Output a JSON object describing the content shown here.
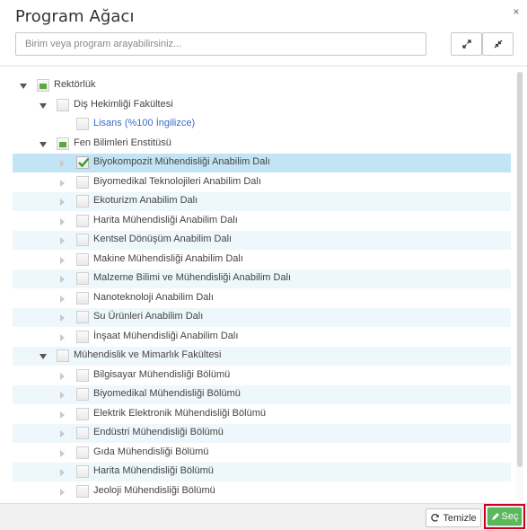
{
  "dialog": {
    "title": "Program Ağacı",
    "close_glyph": "×"
  },
  "search": {
    "placeholder": "Birim veya program arayabilirsiniz..."
  },
  "toolbar": {
    "expand_icon": "expand-icon",
    "collapse_icon": "collapse-icon"
  },
  "tree": {
    "rows": [
      {
        "label": "Rektörlük",
        "level": 0,
        "toggle": "expanded",
        "check": "partial",
        "bg": "none",
        "link": false
      },
      {
        "label": "Diş Hekimliği Fakültesi",
        "level": 1,
        "toggle": "expanded",
        "check": "none",
        "bg": "none",
        "link": false
      },
      {
        "label": "Lisans (%100 İngilizce)",
        "level": 2,
        "toggle": "none",
        "check": "none",
        "bg": "none",
        "link": true
      },
      {
        "label": "Fen Bilimleri Enstitüsü",
        "level": 1,
        "toggle": "expanded",
        "check": "partial",
        "bg": "none",
        "link": false
      },
      {
        "label": "Biyokompozit Mühendisliği Anabilim Dalı",
        "level": 2,
        "toggle": "collapsed",
        "check": "checked",
        "bg": "selected",
        "link": false
      },
      {
        "label": "Biyomedikal Teknolojileri Anabilim Dalı",
        "level": 2,
        "toggle": "collapsed",
        "check": "none",
        "bg": "none",
        "link": false
      },
      {
        "label": "Ekoturizm Anabilim Dalı",
        "level": 2,
        "toggle": "collapsed",
        "check": "none",
        "bg": "alt",
        "link": false
      },
      {
        "label": "Harita Mühendisliği Anabilim Dalı",
        "level": 2,
        "toggle": "collapsed",
        "check": "none",
        "bg": "none",
        "link": false
      },
      {
        "label": "Kentsel Dönüşüm Anabilim Dalı",
        "level": 2,
        "toggle": "collapsed",
        "check": "none",
        "bg": "alt",
        "link": false
      },
      {
        "label": "Makine Mühendisliği Anabilim Dalı",
        "level": 2,
        "toggle": "collapsed",
        "check": "none",
        "bg": "none",
        "link": false
      },
      {
        "label": "Malzeme Bilimi ve Mühendisliği Anabilim Dalı",
        "level": 2,
        "toggle": "collapsed",
        "check": "none",
        "bg": "alt",
        "link": false
      },
      {
        "label": "Nanoteknoloji Anabilim Dalı",
        "level": 2,
        "toggle": "collapsed",
        "check": "none",
        "bg": "none",
        "link": false
      },
      {
        "label": "Su Ürünleri Anabilim Dalı",
        "level": 2,
        "toggle": "collapsed",
        "check": "none",
        "bg": "alt",
        "link": false
      },
      {
        "label": "İnşaat Mühendisliği Anabilim Dalı",
        "level": 2,
        "toggle": "collapsed",
        "check": "none",
        "bg": "none",
        "link": false
      },
      {
        "label": "Mühendislik ve Mimarlık Fakültesi",
        "level": 1,
        "toggle": "expanded",
        "check": "none",
        "bg": "alt",
        "link": false
      },
      {
        "label": "Bilgisayar Mühendisliği Bölümü",
        "level": 2,
        "toggle": "collapsed",
        "check": "none",
        "bg": "none",
        "link": false
      },
      {
        "label": "Biyomedikal Mühendisliği Bölümü",
        "level": 2,
        "toggle": "collapsed",
        "check": "none",
        "bg": "alt",
        "link": false
      },
      {
        "label": "Elektrik Elektronik Mühendisliği Bölümü",
        "level": 2,
        "toggle": "collapsed",
        "check": "none",
        "bg": "none",
        "link": false
      },
      {
        "label": "Endüstri Mühendisliği Bölümü",
        "level": 2,
        "toggle": "collapsed",
        "check": "none",
        "bg": "alt",
        "link": false
      },
      {
        "label": "Gıda Mühendisliği Bölümü",
        "level": 2,
        "toggle": "collapsed",
        "check": "none",
        "bg": "none",
        "link": false
      },
      {
        "label": "Harita Mühendisliği Bölümü",
        "level": 2,
        "toggle": "collapsed",
        "check": "none",
        "bg": "alt",
        "link": false
      },
      {
        "label": "Jeoloji Mühendisliği Bölümü",
        "level": 2,
        "toggle": "collapsed",
        "check": "none",
        "bg": "none",
        "link": false
      }
    ]
  },
  "footer": {
    "clear_label": "Temizle",
    "select_label": "Seç"
  },
  "colors": {
    "selected_row": "#c3e4f5",
    "alt_row": "#eef7fb",
    "link": "#3a6bc8",
    "select_button": "#5cb85c",
    "highlight_border": "#d0021b"
  }
}
